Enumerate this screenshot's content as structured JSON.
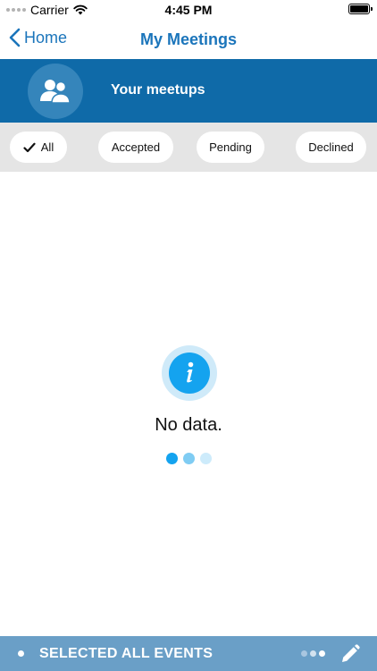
{
  "status_bar": {
    "carrier": "Carrier",
    "time": "4:45 PM"
  },
  "nav": {
    "back_label": "Home",
    "title": "My Meetings"
  },
  "banner": {
    "title": "Your meetups",
    "icon": "group-icon"
  },
  "filters": [
    {
      "label": "All",
      "selected": true
    },
    {
      "label": "Accepted",
      "selected": false
    },
    {
      "label": "Pending",
      "selected": false
    },
    {
      "label": "Declined",
      "selected": false
    }
  ],
  "empty_state": {
    "icon": "info-icon",
    "message": "No data."
  },
  "bottom_bar": {
    "label": "SELECTED ALL EVENTS",
    "icon": "pencil-icon"
  },
  "colors": {
    "accent": "#1b75bb",
    "banner": "#0f6aa8",
    "filter_background": "#e5e5e5",
    "info": "#14a3ef",
    "bottom_bar": "#6a9fc7"
  }
}
